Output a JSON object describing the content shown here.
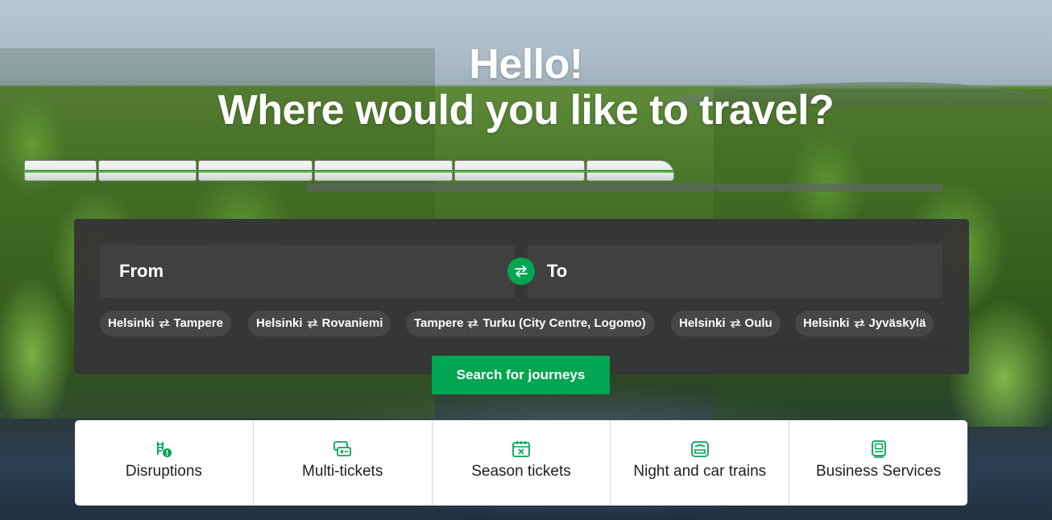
{
  "hero": {
    "greeting": "Hello!",
    "question": "Where would you like to travel?"
  },
  "search": {
    "from_placeholder": "From",
    "to_placeholder": "To",
    "swap_icon": "swap-arrows-icon",
    "submit_label": "Search for journeys",
    "quick_routes": [
      {
        "from": "Helsinki",
        "to": "Tampere"
      },
      {
        "from": "Helsinki",
        "to": "Rovaniemi"
      },
      {
        "from": "Tampere",
        "to": "Turku (City Centre, Logomo)"
      },
      {
        "from": "Helsinki",
        "to": "Oulu"
      },
      {
        "from": "Helsinki",
        "to": "Jyväskylä"
      }
    ]
  },
  "quick_links": [
    {
      "label": "Disruptions",
      "icon": "disruptions-icon"
    },
    {
      "label": "Multi-tickets",
      "icon": "multi-ticket-icon"
    },
    {
      "label": "Season tickets",
      "icon": "season-ticket-icon"
    },
    {
      "label": "Night and car trains",
      "icon": "night-train-icon"
    },
    {
      "label": "Business Services",
      "icon": "business-services-icon"
    }
  ],
  "colors": {
    "accent": "#00a651",
    "panel": "#363636",
    "field": "#404040",
    "chip": "#474747"
  }
}
